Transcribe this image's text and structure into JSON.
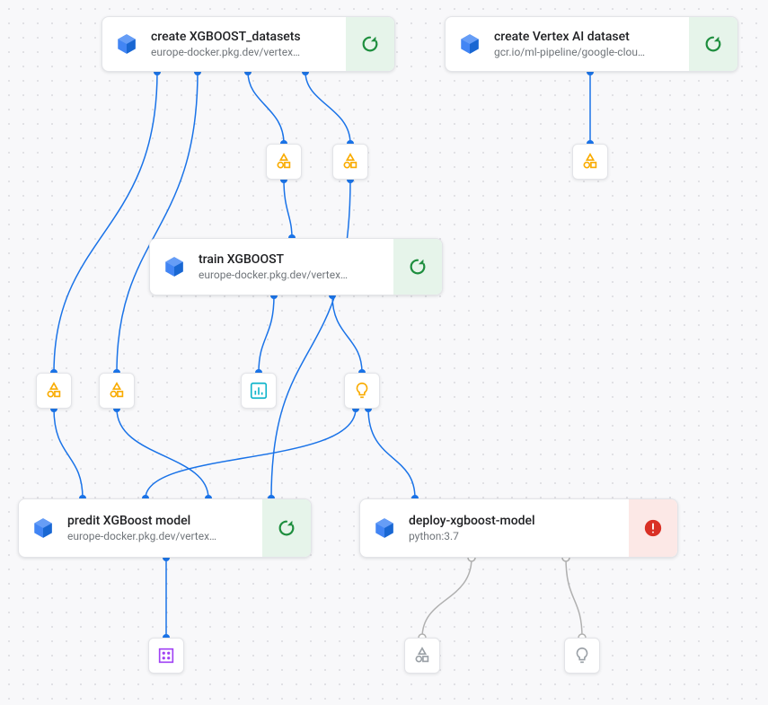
{
  "nodes": {
    "createXgb": {
      "title": "create XGBOOST_datasets",
      "sub": "europe-docker.pkg.dev/vertex…",
      "status": "ok"
    },
    "createVertex": {
      "title": "create Vertex AI dataset",
      "sub": "gcr.io/ml-pipeline/google-clou…",
      "status": "ok"
    },
    "train": {
      "title": "train XGBOOST",
      "sub": "europe-docker.pkg.dev/vertex…",
      "status": "ok"
    },
    "predict": {
      "title": "predit XGBoost model",
      "sub": "europe-docker.pkg.dev/vertex…",
      "status": "ok"
    },
    "deploy": {
      "title": "deploy-xgboost-model",
      "sub": "python:3.7",
      "status": "error"
    }
  },
  "artifacts": {
    "shapesGold": "shapes-icon",
    "metricsTeal": "metrics-icon",
    "bulbGold": "bulb-icon",
    "gridPurple": "grid-icon",
    "shapesGray": "shapes-icon",
    "bulbGray": "bulb-icon"
  },
  "colors": {
    "edge": "#1a73e8",
    "ok": "#1e8e3e",
    "err": "#d93025",
    "gold": "#f9ab00",
    "teal": "#12b5cb",
    "purple": "#a142f4",
    "cube": "#4285f4",
    "gray": "#9aa0a6"
  }
}
